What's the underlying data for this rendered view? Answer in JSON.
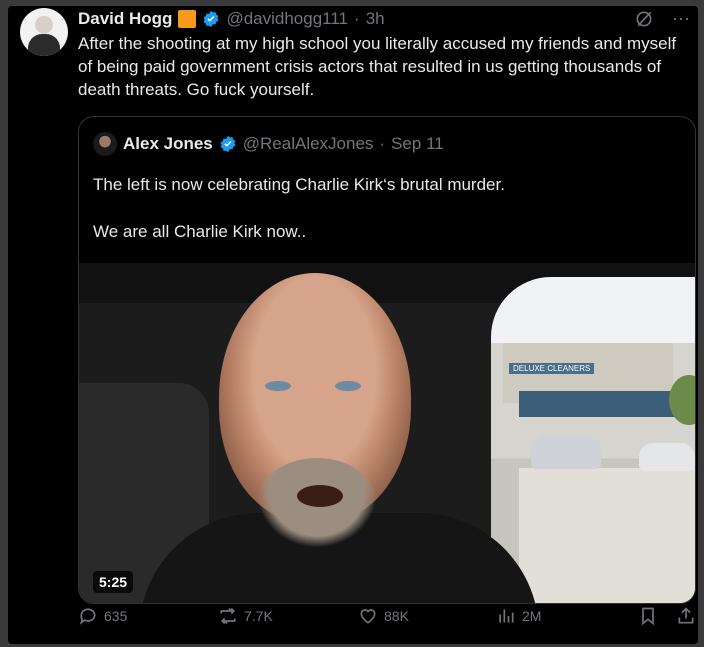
{
  "tweet": {
    "author_name": "David Hogg",
    "handle": "@davidhogg111",
    "separator": "·",
    "time": "3h",
    "text": "After the shooting at my high school you literally accused my friends and myself of being paid government crisis actors that resulted in us getting thousands of death threats. Go fuck yourself.",
    "badge_color": "#f59a1b",
    "verified_color": "#1d9bf0",
    "more_label": "···"
  },
  "quoted_tweet": {
    "author_name": "Alex Jones",
    "handle": "@RealAlexJones",
    "separator": "·",
    "date": "Sep 11",
    "line1": "The left is now celebrating Charlie Kirk‘s brutal murder.",
    "line2": "We are all Charlie Kirk now..",
    "video_duration": "5:25",
    "storefront_sign": "DELUXE CLEANERS"
  },
  "actions": {
    "replies": "635",
    "reposts": "7.7K",
    "likes": "88K",
    "views": "2M"
  }
}
